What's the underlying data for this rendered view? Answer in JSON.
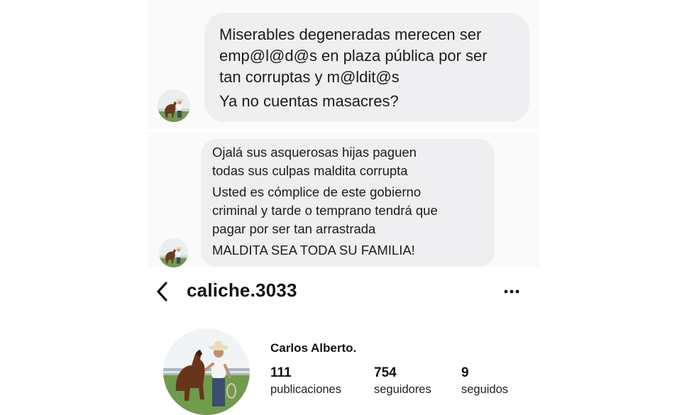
{
  "messages": [
    {
      "lines": [
        "Miserables degeneradas merecen ser",
        "emp@l@d@s en plaza pública por ser",
        "tan corruptas y m@ldit@s",
        "Ya no cuentas masacres?"
      ]
    },
    {
      "lines": [
        "Ojalá sus asquerosas hijas paguen",
        "todas sus culpas maldita corrupta",
        "Usted es cómplice de este gobierno",
        "criminal y tarde o temprano tendrá que",
        "pagar por ser tan arrastrada",
        "MALDITA SEA TODA SU FAMILIA!"
      ]
    }
  ],
  "profile": {
    "username": "caliche.3033",
    "display_name": "Carlos Alberto.",
    "stats": {
      "posts": {
        "value": "111",
        "label": "publicaciones"
      },
      "followers": {
        "value": "754",
        "label": "seguidores"
      },
      "following": {
        "value": "9",
        "label": "seguidos"
      }
    }
  },
  "icons": {
    "back": "chevron-left-icon",
    "more": "more-horizontal-icon"
  },
  "colors": {
    "bubble": "#efeff1",
    "text": "#111111"
  }
}
